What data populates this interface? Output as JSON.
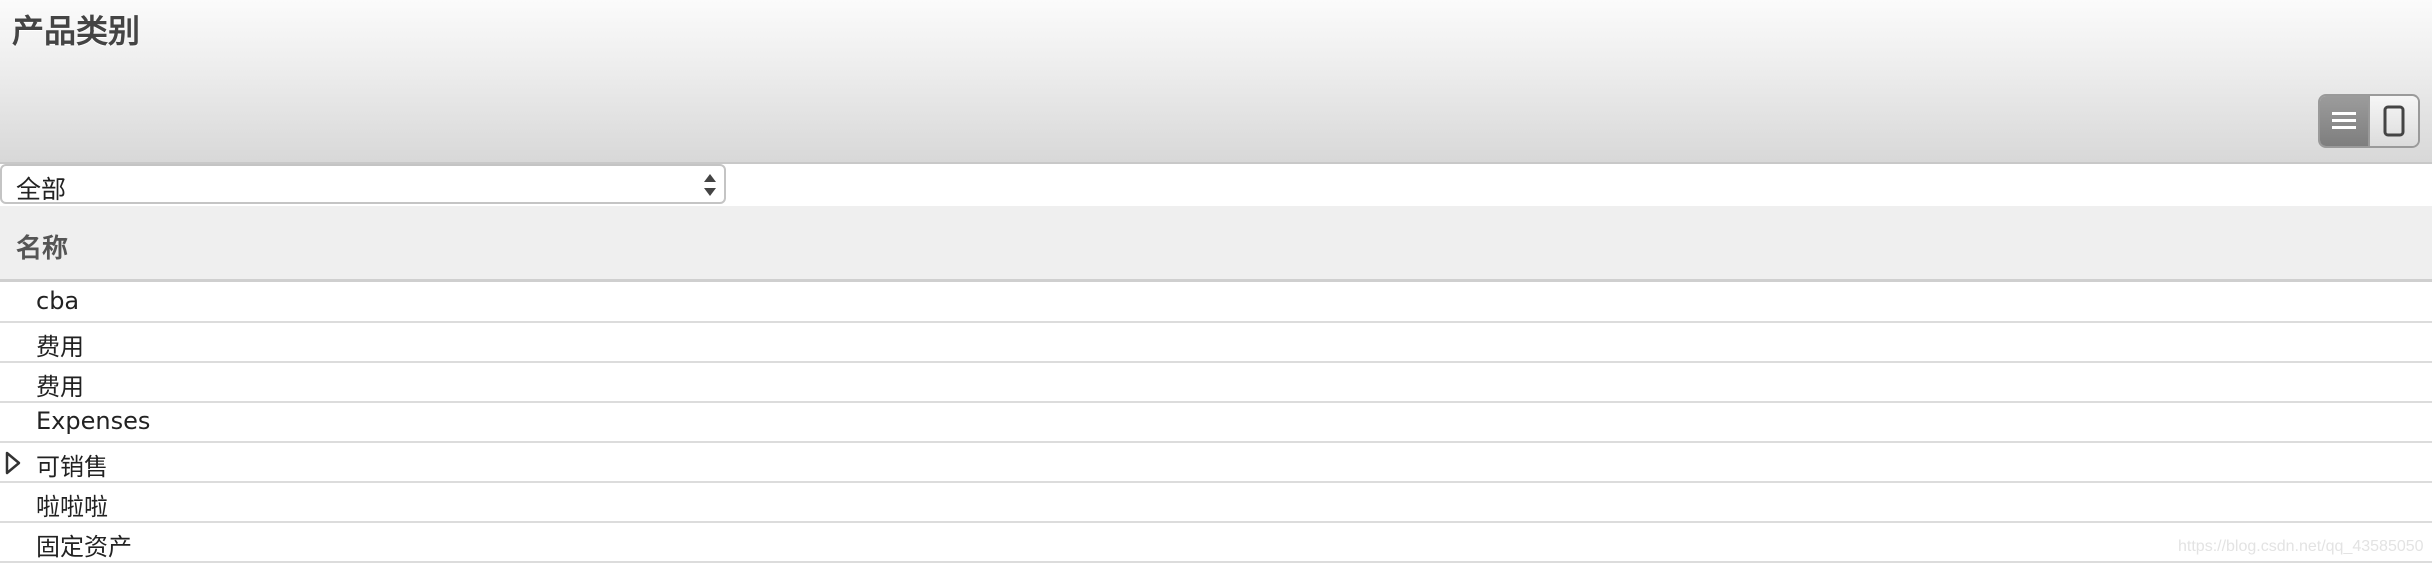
{
  "header": {
    "title": "产品类别",
    "view_toggle": {
      "list_icon": "list-view-icon",
      "form_icon": "form-view-icon",
      "active": "list"
    }
  },
  "filter": {
    "selected": "全部",
    "icon": "updown-arrows-icon"
  },
  "table": {
    "column_header": "名称",
    "rows": [
      {
        "label": "cba",
        "expandable": false
      },
      {
        "label": "费用",
        "expandable": false
      },
      {
        "label": "费用",
        "expandable": false
      },
      {
        "label": "Expenses",
        "expandable": false
      },
      {
        "label": "可销售",
        "expandable": true
      },
      {
        "label": "啦啦啦",
        "expandable": false
      },
      {
        "label": "固定资产",
        "expandable": false
      }
    ]
  },
  "watermark": "https://blog.csdn.net/qq_43585050"
}
